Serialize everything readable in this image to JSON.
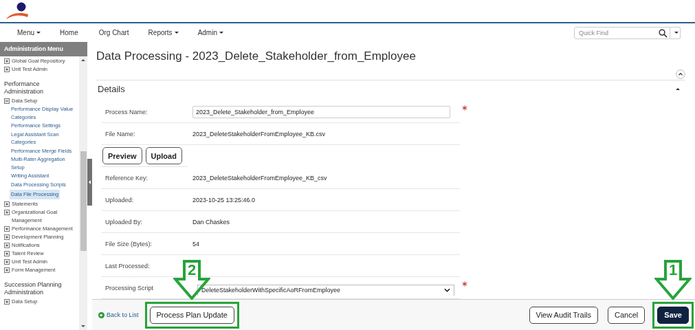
{
  "nav": {
    "items": [
      {
        "label": "Menu",
        "dropdown": true
      },
      {
        "label": "Home",
        "dropdown": false
      },
      {
        "label": "Org Chart",
        "dropdown": false
      },
      {
        "label": "Reports",
        "dropdown": true
      },
      {
        "label": "Admin",
        "dropdown": true
      }
    ],
    "search": {
      "placeholder": "Quick Find"
    }
  },
  "sidebar": {
    "title": "Administration Menu",
    "groups": [
      {
        "items": [
          {
            "label": "Global Goal Repository",
            "expanded": false
          },
          {
            "label": "Unit Test Admin",
            "expanded": false
          }
        ]
      },
      {
        "heading": "Performance Administration",
        "items": [
          {
            "label": "Data Setup",
            "expanded": true,
            "children": [
              {
                "label": "Performance Display Value Categories",
                "selected": false
              },
              {
                "label": "Performance Settings",
                "selected": false
              },
              {
                "label": "Legal Assistant Scan Categories",
                "selected": false
              },
              {
                "label": "Performance Merge Fields",
                "selected": false
              },
              {
                "label": "Multi-Rater Aggregation Setup",
                "selected": false
              },
              {
                "label": "Writing Assistant",
                "selected": false
              },
              {
                "label": "Data Processing Scripts",
                "selected": false
              },
              {
                "label": "Data File Processing",
                "selected": true
              }
            ]
          },
          {
            "label": "Statements",
            "expanded": false
          },
          {
            "label": "Organizational Goal Management",
            "expanded": false
          },
          {
            "label": "Performance Management",
            "expanded": false
          },
          {
            "label": "Development Planning",
            "expanded": false
          },
          {
            "label": "Notifications",
            "expanded": false
          },
          {
            "label": "Talent Review",
            "expanded": false
          },
          {
            "label": "Unit Test Admin",
            "expanded": false
          },
          {
            "label": "Form Management",
            "expanded": false
          }
        ]
      },
      {
        "heading": "Succession Planning Administration",
        "items": [
          {
            "label": "Data Setup",
            "expanded": false
          }
        ]
      }
    ]
  },
  "page": {
    "title": "Data Processing - 2023_Delete_Stakeholder_from_Employee",
    "section": "Details"
  },
  "fields": [
    {
      "kind": "input",
      "label": "Process Name:",
      "value": "2023_Delete_Stakeholder_from_Employee",
      "required": true
    },
    {
      "kind": "text",
      "label": "File Name:",
      "value": "2023_DeleteStakeholderFromEmployee_KB.csv"
    },
    {
      "kind": "buttons",
      "buttons": [
        "Preview",
        "Upload"
      ]
    },
    {
      "kind": "text",
      "label": "Reference Key:",
      "value": "2023_DeleteStakeholderFromEmployee_KB_csv"
    },
    {
      "kind": "text",
      "label": "Uploaded:",
      "value": "2023-10-25 13:25:46.0"
    },
    {
      "kind": "text",
      "label": "Uploaded By:",
      "value": "Dan Chaskes"
    },
    {
      "kind": "text",
      "label": "File Size (Bytes):",
      "value": "54"
    },
    {
      "kind": "text",
      "label": "Last Processed:"
    },
    {
      "kind": "select",
      "label": "Processing Script",
      "value": "DeleteStakeholderWithSpecificAoRFromEmployee",
      "required": true
    }
  ],
  "footer": {
    "back_link": "Back to List",
    "left_buttons": [
      {
        "label": "Process Plan Update",
        "primary": false,
        "callout": "2"
      }
    ],
    "right_buttons": [
      {
        "label": "View Audit Trails",
        "primary": false
      },
      {
        "label": "Cancel",
        "primary": false
      },
      {
        "label": "Save",
        "primary": true,
        "callout": "1"
      }
    ]
  }
}
